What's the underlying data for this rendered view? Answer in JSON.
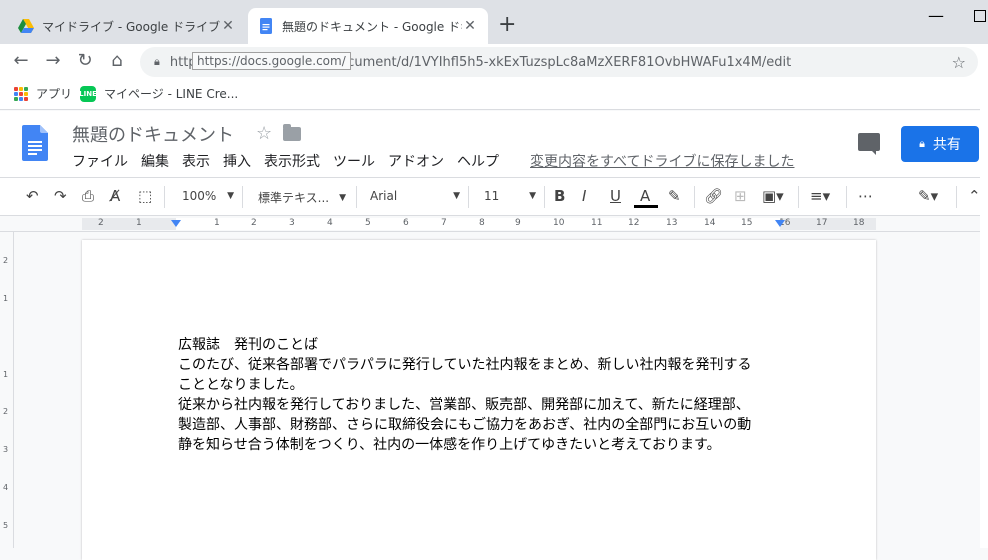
{
  "browser": {
    "tabs": [
      {
        "title": "マイドライブ - Google ドライブ",
        "active": false
      },
      {
        "title": "無題のドキュメント - Google ドキュメ",
        "active": true
      }
    ],
    "url": "https://docs.google.com/document/d/1VYIhfl5h5-xkExTuzspLc8aMzXERF81OvbHWAFu1x4M/edit",
    "url_tooltip": "https://docs.google.com/",
    "bookmarks": [
      {
        "label": "アプリ",
        "icon": "apps-grid-icon"
      },
      {
        "label": "マイページ - LINE Cre...",
        "icon": "line-icon"
      }
    ]
  },
  "docs": {
    "title": "無題のドキュメント",
    "menu": [
      "ファイル",
      "編集",
      "表示",
      "挿入",
      "表示形式",
      "ツール",
      "アドオン",
      "ヘルプ"
    ],
    "save_status": "変更内容をすべてドライブに保存しました",
    "share_label": "共有"
  },
  "toolbar": {
    "zoom": "100%",
    "style": "標準テキス...",
    "font": "Arial",
    "font_size": "11"
  },
  "ruler": {
    "numbers": [
      "2",
      "1",
      "1",
      "2",
      "3",
      "4",
      "5",
      "6",
      "7",
      "8",
      "9",
      "10",
      "11",
      "12",
      "13",
      "14",
      "15",
      "16",
      "17",
      "18"
    ],
    "vertical_numbers": [
      "2",
      "1",
      "1",
      "2",
      "3",
      "4",
      "5"
    ]
  },
  "document": {
    "lines": [
      "広報誌　発刊のことば",
      "このたび、従来各部署でパラパラに発行していた社内報をまとめ、新しい社内報を発刊する",
      "こととなりました。",
      "従来から社内報を発行しておりました、営業部、販売部、開発部に加えて、新たに経理部、",
      "製造部、人事部、財務部、さらに取締役会にもご協力をあおぎ、社内の全部門にお互いの動",
      "静を知らせ合う体制をつくり、社内の一体感を作り上げてゆきたいと考えております。"
    ]
  },
  "colors": {
    "docs_blue": "#4285f4",
    "share_blue": "#1a73e8",
    "line_green": "#06c755"
  }
}
